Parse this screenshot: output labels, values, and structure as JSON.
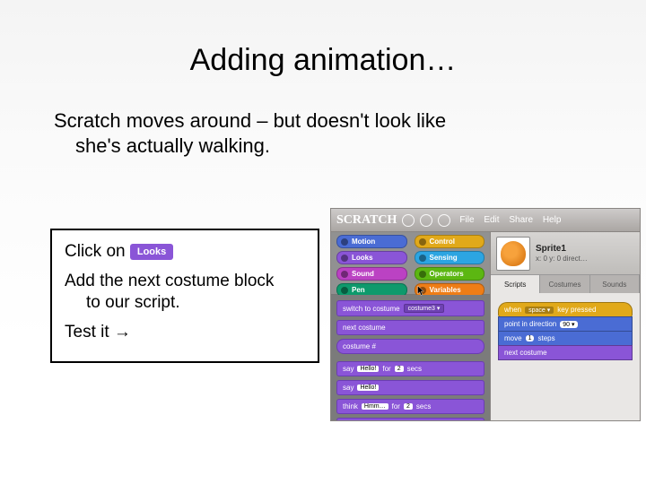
{
  "slide": {
    "title": "Adding animation…",
    "subtitle_line1": "Scratch moves around – but doesn't look like",
    "subtitle_line2": "she's actually walking."
  },
  "box": {
    "click_on": "Click on",
    "looks_pill": "Looks",
    "line2a": "Add the next costume block",
    "line2b": "to our script.",
    "line3": "Test it →"
  },
  "scratch": {
    "logo": "SCRATCH",
    "menu": {
      "file": "File",
      "edit": "Edit",
      "share": "Share",
      "help": "Help"
    },
    "categories": {
      "motion": {
        "label": "Motion",
        "color": "#4a6cd4"
      },
      "control": {
        "label": "Control",
        "color": "#e1a91a"
      },
      "looks": {
        "label": "Looks",
        "color": "#8a55d7"
      },
      "sensing": {
        "label": "Sensing",
        "color": "#2ca5e2"
      },
      "sound": {
        "label": "Sound",
        "color": "#bb42c3"
      },
      "operators": {
        "label": "Operators",
        "color": "#5cb712"
      },
      "pen": {
        "label": "Pen",
        "color": "#0e9a6c"
      },
      "variables": {
        "label": "Variables",
        "color": "#ee7d16"
      }
    },
    "palette": {
      "switch_to_costume": "switch to costume",
      "switch_dd": "costume3 ▾",
      "next_costume": "next costume",
      "costume_num": "costume #",
      "say_for": "say",
      "hello": "Hello!",
      "for": "for",
      "two": "2",
      "secs": "secs",
      "say": "say",
      "think_for": "think",
      "hmm": "Hmm…",
      "think": "think"
    },
    "sprite": {
      "name": "Sprite1",
      "coords": "x: 0   y: 0   direct…"
    },
    "tabs": {
      "scripts": "Scripts",
      "costumes": "Costumes",
      "sounds": "Sounds"
    },
    "script": {
      "when": "when",
      "space": "space ▾",
      "key_pressed": "key pressed",
      "point_dir": "point in direction",
      "ninety": "90 ▾",
      "move": "move",
      "one": "1",
      "steps": "steps",
      "next_costume": "next costume"
    },
    "colors": {
      "control": "#e1a91a",
      "motion": "#4a6cd4",
      "looks": "#8a55d7"
    }
  }
}
